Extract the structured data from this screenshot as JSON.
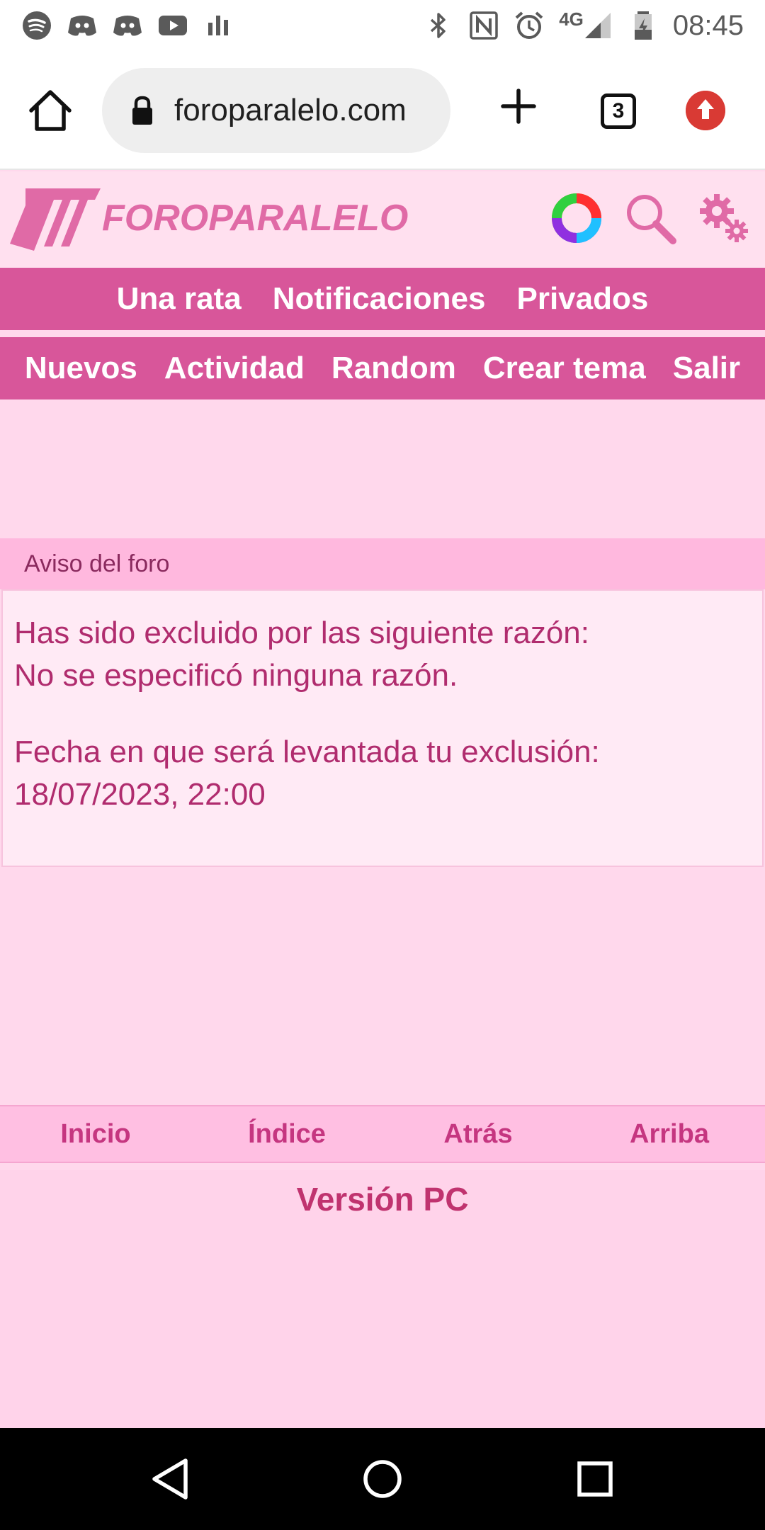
{
  "status_bar": {
    "time": "08:45",
    "network": "4G",
    "left_icons": [
      "spotify-icon",
      "discord-icon",
      "discord-icon",
      "youtube-icon",
      "equalizer-icon"
    ],
    "right_icons": [
      "bluetooth-icon",
      "nfc-icon",
      "alarm-icon",
      "signal-icon",
      "battery-icon"
    ]
  },
  "browser": {
    "url": "foroparalelo.com",
    "tab_count": "3"
  },
  "site": {
    "logo_text": "FOROPARALELO",
    "brand_color": "#d8569a",
    "nav_top": [
      {
        "label": "Una rata"
      },
      {
        "label": "Notificaciones"
      },
      {
        "label": "Privados"
      }
    ],
    "nav_main": [
      {
        "label": "Nuevos"
      },
      {
        "label": "Actividad"
      },
      {
        "label": "Random"
      },
      {
        "label": "Crear tema"
      },
      {
        "label": "Salir"
      }
    ]
  },
  "notice": {
    "header": "Aviso del foro",
    "line1": "Has sido excluido por las siguiente razón:",
    "line2": "No se especificó ninguna razón.",
    "line3": "Fecha en que será levantada tu exclusión:",
    "line4": "18/07/2023, 22:00"
  },
  "footer": {
    "links": [
      {
        "label": "Inicio"
      },
      {
        "label": "Índice"
      },
      {
        "label": "Atrás"
      },
      {
        "label": "Arriba"
      }
    ],
    "pc_version": "Versión PC"
  }
}
